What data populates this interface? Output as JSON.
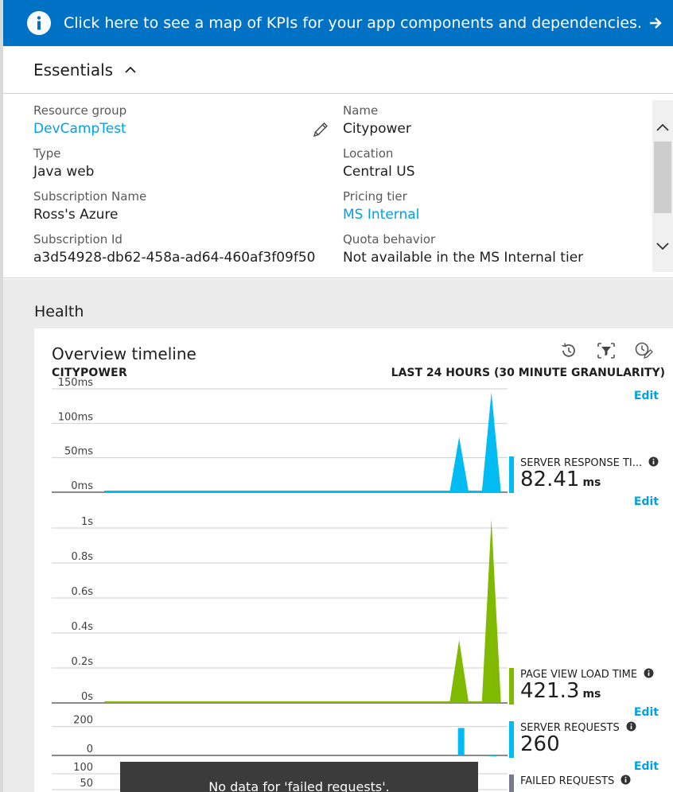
{
  "banner": {
    "text": "Click here to see a map of KPIs for your app components and dependencies.",
    "accent": "#0072c6"
  },
  "essentials": {
    "title": "Essentials",
    "fields": {
      "resource_group": {
        "label": "Resource group",
        "value": "DevCampTest"
      },
      "type": {
        "label": "Type",
        "value": "Java web"
      },
      "subscription_name": {
        "label": "Subscription Name",
        "value": "Ross's Azure"
      },
      "subscription_id": {
        "label": "Subscription Id",
        "value": "a3d54928-db62-458a-ad64-460af3f09f50"
      },
      "name": {
        "label": "Name",
        "value": "Citypower"
      },
      "location": {
        "label": "Location",
        "value": "Central US"
      },
      "pricing_tier": {
        "label": "Pricing tier",
        "value": "MS Internal"
      },
      "quota_behavior": {
        "label": "Quota behavior",
        "value": "Not available in the MS Internal tier"
      }
    }
  },
  "health": {
    "title": "Health",
    "tile": {
      "title": "Overview timeline",
      "resource": "CITYPOWER",
      "range": "LAST 24 HOURS (30 MINUTE GRANULARITY)",
      "edit_label": "Edit",
      "tools": [
        "history-icon",
        "filter-icon",
        "edit-time-icon"
      ],
      "no_data_message": "No data for 'failed requests'."
    },
    "metrics": [
      {
        "name": "SERVER RESPONSE TI...",
        "value": "82.41",
        "unit": "ms",
        "color": "#00bcf2"
      },
      {
        "name": "PAGE VIEW LOAD TIME",
        "value": "421.3",
        "unit": "ms",
        "color": "#7fba00"
      },
      {
        "name": "SERVER REQUESTS",
        "value": "260",
        "unit": "",
        "color": "#00bcf2"
      },
      {
        "name": "FAILED REQUESTS",
        "value": "",
        "unit": "",
        "color": "#7a7a8c"
      }
    ]
  },
  "chart_data": [
    {
      "type": "area",
      "series": [
        {
          "name": "SERVER RESPONSE TI...",
          "color": "#00bcf2",
          "peaks": [
            {
              "x_fraction": 0.88,
              "value": 80
            },
            {
              "x_fraction": 0.96,
              "value": 145
            }
          ]
        }
      ],
      "yticks": [
        "0ms",
        "50ms",
        "100ms",
        "150ms"
      ],
      "ylim": [
        0,
        150
      ]
    },
    {
      "type": "area",
      "series": [
        {
          "name": "PAGE VIEW LOAD TIME",
          "color": "#7fba00",
          "peaks": [
            {
              "x_fraction": 0.88,
              "value": 0.36
            },
            {
              "x_fraction": 0.96,
              "value": 1.05
            }
          ]
        }
      ],
      "yticks": [
        "0s",
        "0.2s",
        "0.4s",
        "0.6s",
        "0.8s",
        "1s"
      ],
      "ylim": [
        0,
        1.05
      ]
    },
    {
      "type": "bar",
      "series": [
        {
          "name": "SERVER REQUESTS",
          "color": "#00bcf2",
          "bars": [
            {
              "x_fraction": 0.885,
              "value": 190
            },
            {
              "x_fraction": 0.965,
              "value": 5
            }
          ]
        }
      ],
      "yticks": [
        "0",
        "200"
      ],
      "ylim": [
        0,
        220
      ]
    },
    {
      "type": "bar",
      "series": [
        {
          "name": "FAILED REQUESTS",
          "color": "#7a7a8c",
          "bars": []
        }
      ],
      "yticks": [
        "50",
        "100"
      ],
      "ylim": [
        0,
        120
      ]
    }
  ]
}
